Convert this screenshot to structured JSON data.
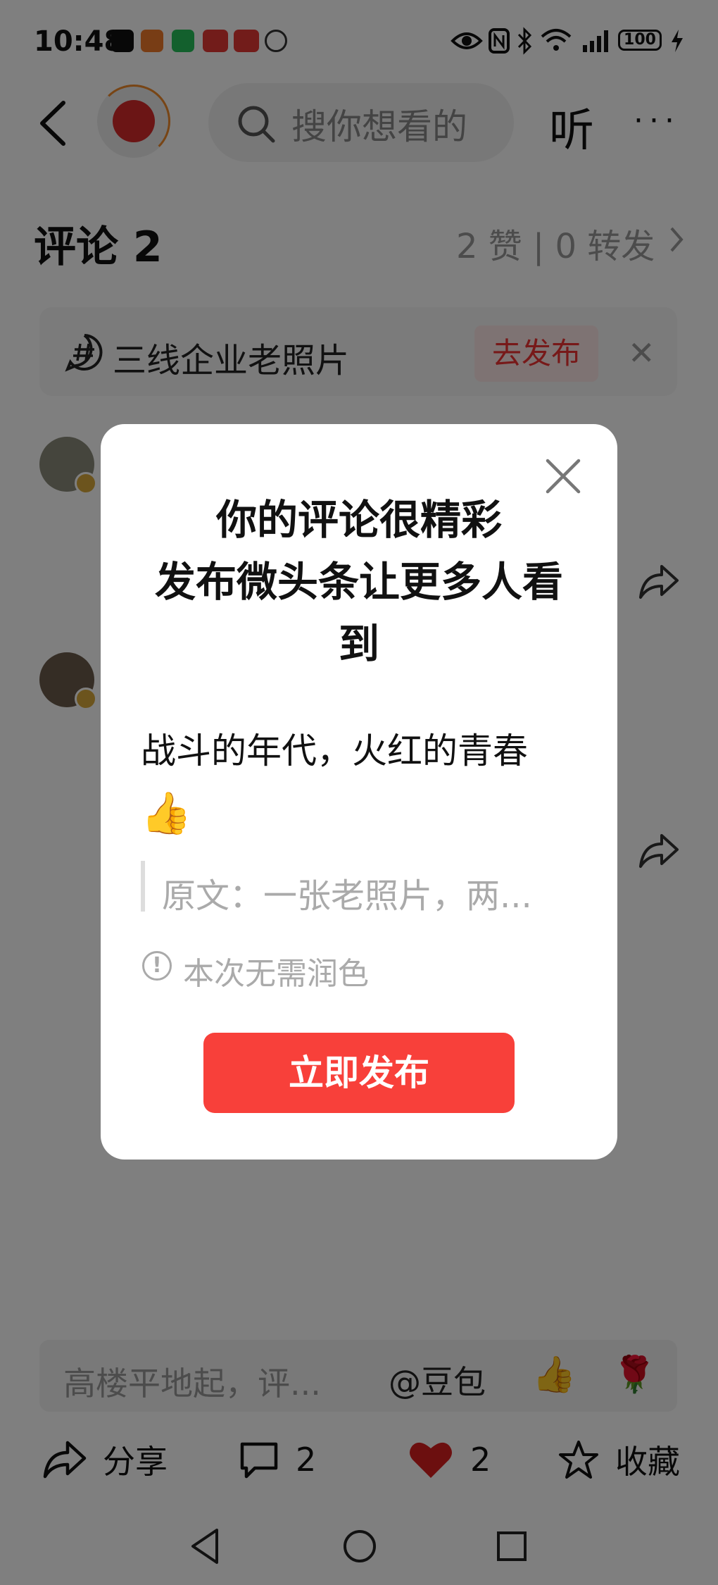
{
  "status_bar": {
    "time": "10:48",
    "battery": "100",
    "app_icons": [
      "tiktok-icon",
      "taobao-icon",
      "wechat-icon",
      "toutiao-icon",
      "red-book-icon",
      "xiaohongshu-icon"
    ]
  },
  "header": {
    "search_placeholder": "搜你想看的",
    "listen_label": "听",
    "more_label": "···"
  },
  "comments": {
    "title": "评论 2",
    "stats": "2 赞 | 0 转发"
  },
  "topic_banner": {
    "label": "三线企业老照片",
    "publish_button": "去发布",
    "close_label": "✕"
  },
  "modal": {
    "title_line1": "你的评论很精彩",
    "title_line2": "发布微头条让更多人看",
    "title_line3": "到",
    "comment_text": "战斗的年代，火红的青春",
    "comment_emoji": "👍",
    "quote_text": "原文：一张老照片，两...",
    "notice_text": "本次无需润色",
    "publish_button": "立即发布"
  },
  "input_bar": {
    "placeholder": "高楼平地起，评...",
    "doubao": "@豆包",
    "emoji1": "👍",
    "emoji2": "🌹"
  },
  "action_bar": {
    "share_label": "分享",
    "comment_count": "2",
    "like_count": "2",
    "favorite_label": "收藏"
  },
  "colors": {
    "accent_red": "#f8403a",
    "like_red": "#d81e1e"
  }
}
